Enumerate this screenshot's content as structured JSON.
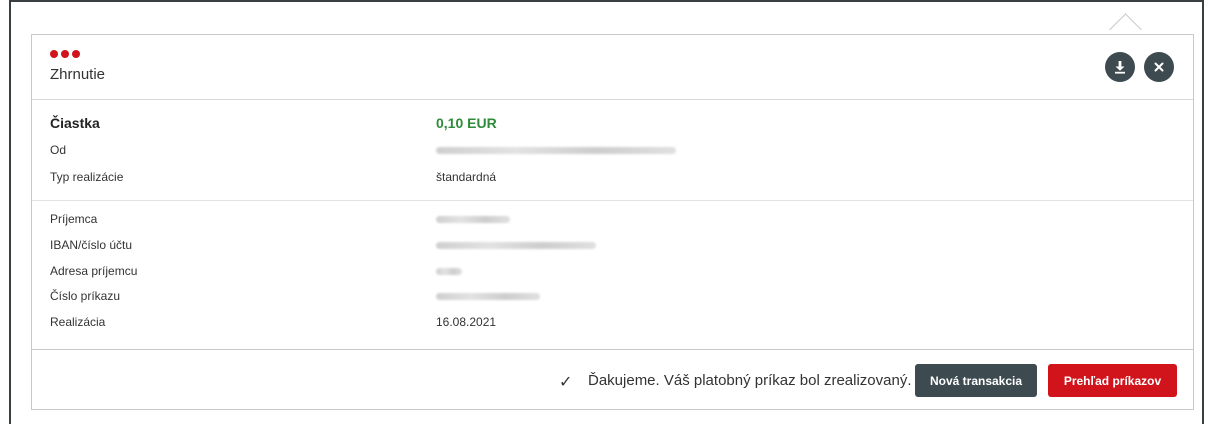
{
  "summary": {
    "title": "Zhrnutie"
  },
  "details": {
    "amount_label": "Čiastka",
    "amount_value": "0,10 EUR",
    "from_label": "Od",
    "type_label": "Typ realizácie",
    "type_value": "štandardná"
  },
  "recipient": {
    "name_label": "Príjemca",
    "iban_label": "IBAN/číslo účtu",
    "address_label": "Adresa príjemcu",
    "order_label": "Číslo príkazu",
    "realization_label": "Realizácia",
    "realization_value": "16.08.2021"
  },
  "footer": {
    "message": "Ďakujeme. Váš platobný príkaz bol zrealizovaný.",
    "new_transaction_label": "Nová transakcia",
    "orders_overview_label": "Prehľad príkazov"
  },
  "icons": {
    "download": "download-icon",
    "close": "close-icon",
    "check": "check-icon"
  },
  "colors": {
    "brand_red": "#d1131b",
    "amount_green": "#2e8b3a",
    "dark_button": "#3d4a50"
  }
}
